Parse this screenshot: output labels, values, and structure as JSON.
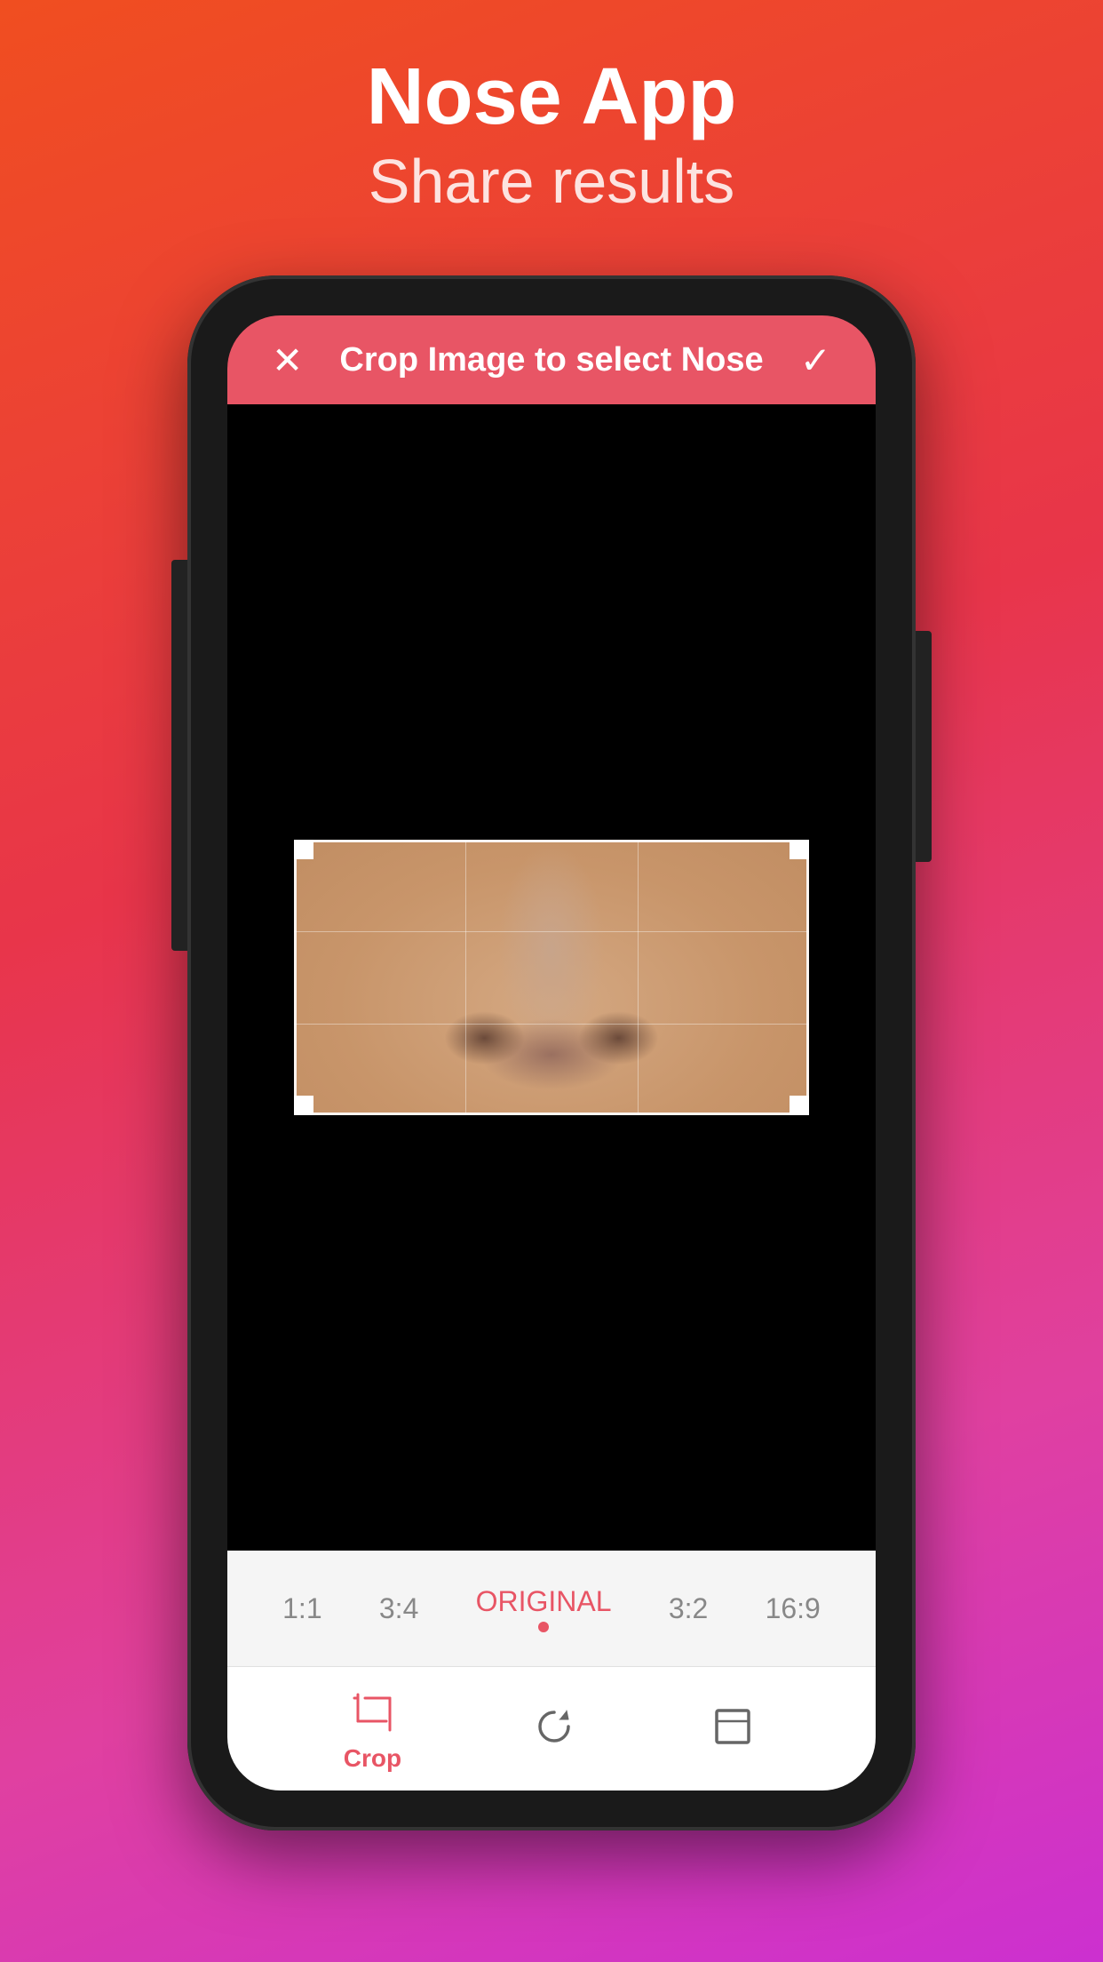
{
  "header": {
    "title": "Nose App",
    "subtitle": "Share results"
  },
  "crop_bar": {
    "title": "Crop Image to select Nose",
    "close_icon": "✕",
    "confirm_icon": "✓"
  },
  "ratio_options": [
    {
      "label": "1:1",
      "active": false
    },
    {
      "label": "3:4",
      "active": false
    },
    {
      "label": "ORIGINAL",
      "active": true
    },
    {
      "label": "3:2",
      "active": false
    },
    {
      "label": "16:9",
      "active": false
    }
  ],
  "toolbar": {
    "items": [
      {
        "id": "crop",
        "label": "Crop",
        "active": true
      },
      {
        "id": "rotate",
        "label": "",
        "active": false
      },
      {
        "id": "expand",
        "label": "",
        "active": false
      }
    ]
  },
  "colors": {
    "accent": "#e85565",
    "background_gradient_start": "#f04e20",
    "background_gradient_end": "#cc30d0"
  }
}
